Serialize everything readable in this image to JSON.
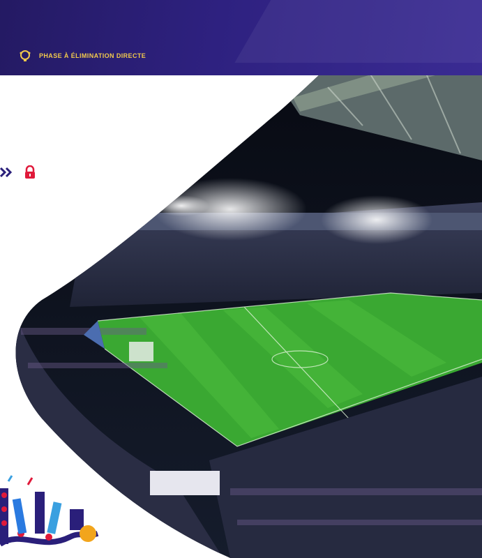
{
  "banner": {
    "phase_label": "PHASE À ÉLIMINATION DIRECTE",
    "phase_icon": "trophy-icon"
  },
  "colors": {
    "banner": "#2e2180",
    "accent_gold": "#f2c94c",
    "nav_arrows": "#2a1f7a",
    "lock_red": "#e0193a",
    "pitch_green": "#3aa832"
  },
  "icons": {
    "nav": "double-chevron-right-icon",
    "lock": "lock-icon",
    "decor": "confetti-decoration-icon"
  }
}
